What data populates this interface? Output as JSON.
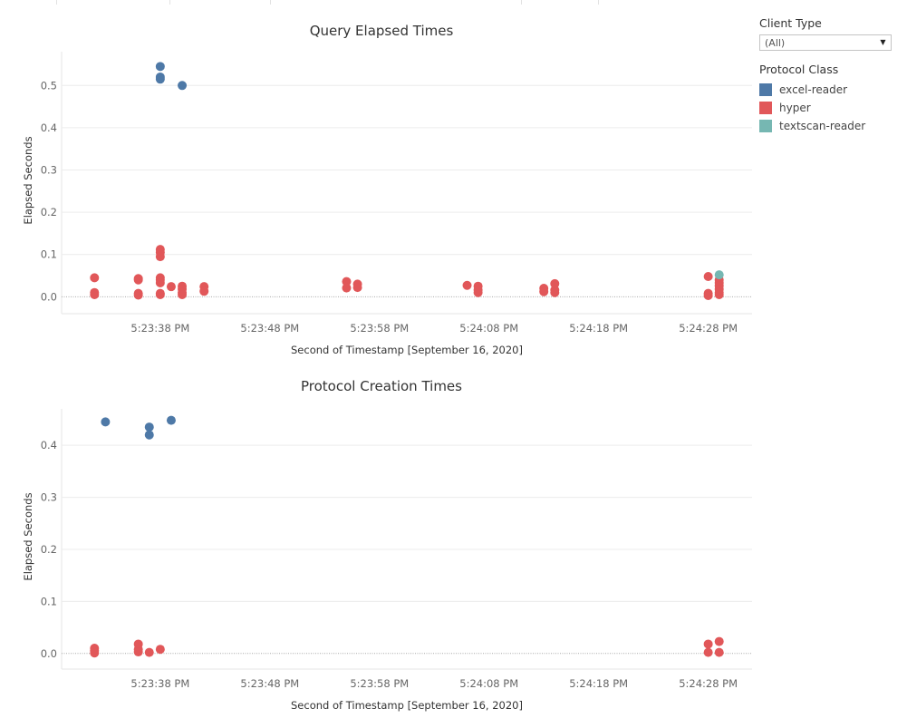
{
  "colors": {
    "excel-reader": "#4e79a7",
    "hyper": "#e15759",
    "textscan-reader": "#76b7b2"
  },
  "filter": {
    "title": "Client Type",
    "selected": "(All)"
  },
  "legend": {
    "title": "Protocol Class",
    "items": [
      {
        "label": "excel-reader",
        "color": "#4e79a7"
      },
      {
        "label": "hyper",
        "color": "#e15759"
      },
      {
        "label": "textscan-reader",
        "color": "#76b7b2"
      }
    ]
  },
  "chart_data": [
    {
      "type": "scatter",
      "title": "Query Elapsed Times",
      "xlabel": "Second of Timestamp [September 16, 2020]",
      "ylabel": "Elapsed Seconds",
      "x_ticks": [
        "5:23:38 PM",
        "5:23:48 PM",
        "5:23:58 PM",
        "5:24:08 PM",
        "5:24:18 PM",
        "5:24:28 PM"
      ],
      "y_ticks": [
        "0.0",
        "0.1",
        "0.2",
        "0.3",
        "0.4",
        "0.5"
      ],
      "xlim": [
        "5:23:29 PM",
        "5:24:32 PM"
      ],
      "ylim": [
        -0.04,
        0.58
      ],
      "grid": true,
      "series": [
        {
          "name": "excel-reader",
          "points": [
            [
              "5:23:38 PM",
              0.545
            ],
            [
              "5:23:38 PM",
              0.52
            ],
            [
              "5:23:38 PM",
              0.515
            ],
            [
              "5:23:40 PM",
              0.5
            ]
          ]
        },
        {
          "name": "hyper",
          "points": [
            [
              "5:23:32 PM",
              0.045
            ],
            [
              "5:23:32 PM",
              0.01
            ],
            [
              "5:23:32 PM",
              0.005
            ],
            [
              "5:23:36 PM",
              0.043
            ],
            [
              "5:23:36 PM",
              0.04
            ],
            [
              "5:23:36 PM",
              0.008
            ],
            [
              "5:23:36 PM",
              0.004
            ],
            [
              "5:23:38 PM",
              0.112
            ],
            [
              "5:23:38 PM",
              0.105
            ],
            [
              "5:23:38 PM",
              0.095
            ],
            [
              "5:23:38 PM",
              0.045
            ],
            [
              "5:23:38 PM",
              0.04
            ],
            [
              "5:23:38 PM",
              0.033
            ],
            [
              "5:23:38 PM",
              0.008
            ],
            [
              "5:23:38 PM",
              0.005
            ],
            [
              "5:23:39 PM",
              0.024
            ],
            [
              "5:23:40 PM",
              0.025
            ],
            [
              "5:23:40 PM",
              0.018
            ],
            [
              "5:23:40 PM",
              0.01
            ],
            [
              "5:23:40 PM",
              0.005
            ],
            [
              "5:23:42 PM",
              0.024
            ],
            [
              "5:23:42 PM",
              0.013
            ],
            [
              "5:23:55 PM",
              0.036
            ],
            [
              "5:23:55 PM",
              0.021
            ],
            [
              "5:23:56 PM",
              0.03
            ],
            [
              "5:23:56 PM",
              0.022
            ],
            [
              "5:24:06 PM",
              0.027
            ],
            [
              "5:24:07 PM",
              0.025
            ],
            [
              "5:24:07 PM",
              0.016
            ],
            [
              "5:24:07 PM",
              0.01
            ],
            [
              "5:24:13 PM",
              0.02
            ],
            [
              "5:24:13 PM",
              0.012
            ],
            [
              "5:24:14 PM",
              0.031
            ],
            [
              "5:24:14 PM",
              0.016
            ],
            [
              "5:24:14 PM",
              0.01
            ],
            [
              "5:24:28 PM",
              0.048
            ],
            [
              "5:24:28 PM",
              0.008
            ],
            [
              "5:24:28 PM",
              0.003
            ],
            [
              "5:24:29 PM",
              0.04
            ],
            [
              "5:24:29 PM",
              0.033
            ],
            [
              "5:24:29 PM",
              0.026
            ],
            [
              "5:24:29 PM",
              0.018
            ],
            [
              "5:24:29 PM",
              0.01
            ],
            [
              "5:24:29 PM",
              0.005
            ]
          ]
        },
        {
          "name": "textscan-reader",
          "points": [
            [
              "5:24:29 PM",
              0.052
            ]
          ]
        }
      ]
    },
    {
      "type": "scatter",
      "title": "Protocol Creation Times",
      "xlabel": "Second of Timestamp [September 16, 2020]",
      "ylabel": "Elapsed Seconds",
      "x_ticks": [
        "5:23:38 PM",
        "5:23:48 PM",
        "5:23:58 PM",
        "5:24:08 PM",
        "5:24:18 PM",
        "5:24:28 PM"
      ],
      "y_ticks": [
        "0.0",
        "0.1",
        "0.2",
        "0.3",
        "0.4"
      ],
      "xlim": [
        "5:23:29 PM",
        "5:24:32 PM"
      ],
      "ylim": [
        -0.03,
        0.47
      ],
      "grid": true,
      "series": [
        {
          "name": "excel-reader",
          "points": [
            [
              "5:23:33 PM",
              0.445
            ],
            [
              "5:23:37 PM",
              0.435
            ],
            [
              "5:23:37 PM",
              0.42
            ],
            [
              "5:23:39 PM",
              0.448
            ]
          ]
        },
        {
          "name": "hyper",
          "points": [
            [
              "5:23:32 PM",
              0.01
            ],
            [
              "5:23:32 PM",
              0.005
            ],
            [
              "5:23:32 PM",
              0.001
            ],
            [
              "5:23:36 PM",
              0.018
            ],
            [
              "5:23:36 PM",
              0.008
            ],
            [
              "5:23:36 PM",
              0.003
            ],
            [
              "5:23:37 PM",
              0.002
            ],
            [
              "5:23:38 PM",
              0.008
            ],
            [
              "5:24:28 PM",
              0.018
            ],
            [
              "5:24:28 PM",
              0.002
            ],
            [
              "5:24:29 PM",
              0.023
            ],
            [
              "5:24:29 PM",
              0.002
            ]
          ]
        }
      ]
    }
  ]
}
